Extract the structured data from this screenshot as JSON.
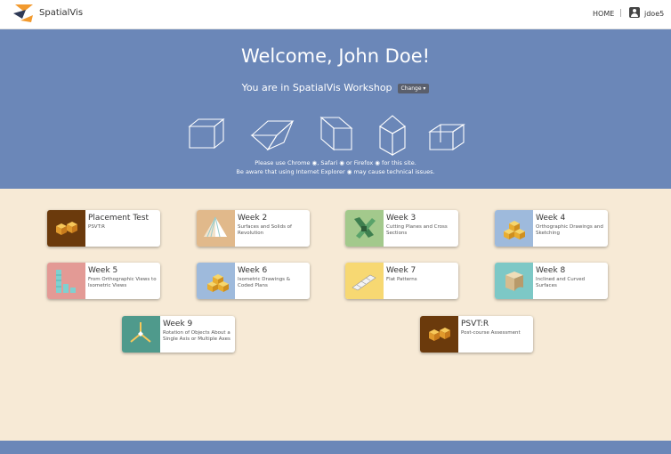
{
  "header": {
    "app_name": "SpatialVis",
    "nav_home": "HOME",
    "separator": "|",
    "username": "jdoe5",
    "logo_icon": "spatialvis-logo",
    "user_icon": "user-icon"
  },
  "hero": {
    "welcome": "Welcome, John Doe!",
    "workshop_text": "You are in SpatialVis Workshop",
    "change_label": "Change ▾",
    "browser_note_1": "Please use Chrome ◉, Safari ◉ or Firefox ◉ for this site.",
    "browser_note_2": "Be aware that using Internet Explorer ◉ may cause technical issues.",
    "background_color": "#6b87b8"
  },
  "cards": [
    {
      "title": "Placement Test",
      "subtitle": "PSVT:R",
      "thumb_color": "#6b3a0c",
      "icon": "cubes-pair-icon"
    },
    {
      "title": "Week 2",
      "subtitle": "Surfaces and Solids of Revolution",
      "thumb_color": "#e1b98b",
      "icon": "pyramid-icon"
    },
    {
      "title": "Week 3",
      "subtitle": "Cutting Planes and Cross Sections",
      "thumb_color": "#a3c98c",
      "icon": "cross-section-icon"
    },
    {
      "title": "Week 4",
      "subtitle": "Orthographic Drawings and Sketching",
      "thumb_color": "#9ebadc",
      "icon": "stacked-cubes-icon"
    },
    {
      "title": "Week 5",
      "subtitle": "From Orthographic Views to Isometric Views",
      "thumb_color": "#e39a95",
      "icon": "block-columns-icon"
    },
    {
      "title": "Week 6",
      "subtitle": "Isometric Drawings & Coded Plans",
      "thumb_color": "#9ebadc",
      "icon": "cube-stack-icon"
    },
    {
      "title": "Week 7",
      "subtitle": "Flat Patterns",
      "thumb_color": "#f7d872",
      "icon": "flat-pattern-icon"
    },
    {
      "title": "Week 8",
      "subtitle": "Inclined and Curved Surfaces",
      "thumb_color": "#7dc8c6",
      "icon": "curved-block-icon"
    },
    {
      "title": "Week 9",
      "subtitle": "Rotation of Objects About a Single Axis or Multiple Axes",
      "thumb_color": "#4f9a8c",
      "icon": "rotation-axes-icon"
    },
    {
      "title": "PSVT:R",
      "subtitle": "Post-course Assessment",
      "thumb_color": "#6b3a0c",
      "icon": "cubes-pair-icon"
    }
  ],
  "footer": {
    "color": "#6b87b8"
  }
}
